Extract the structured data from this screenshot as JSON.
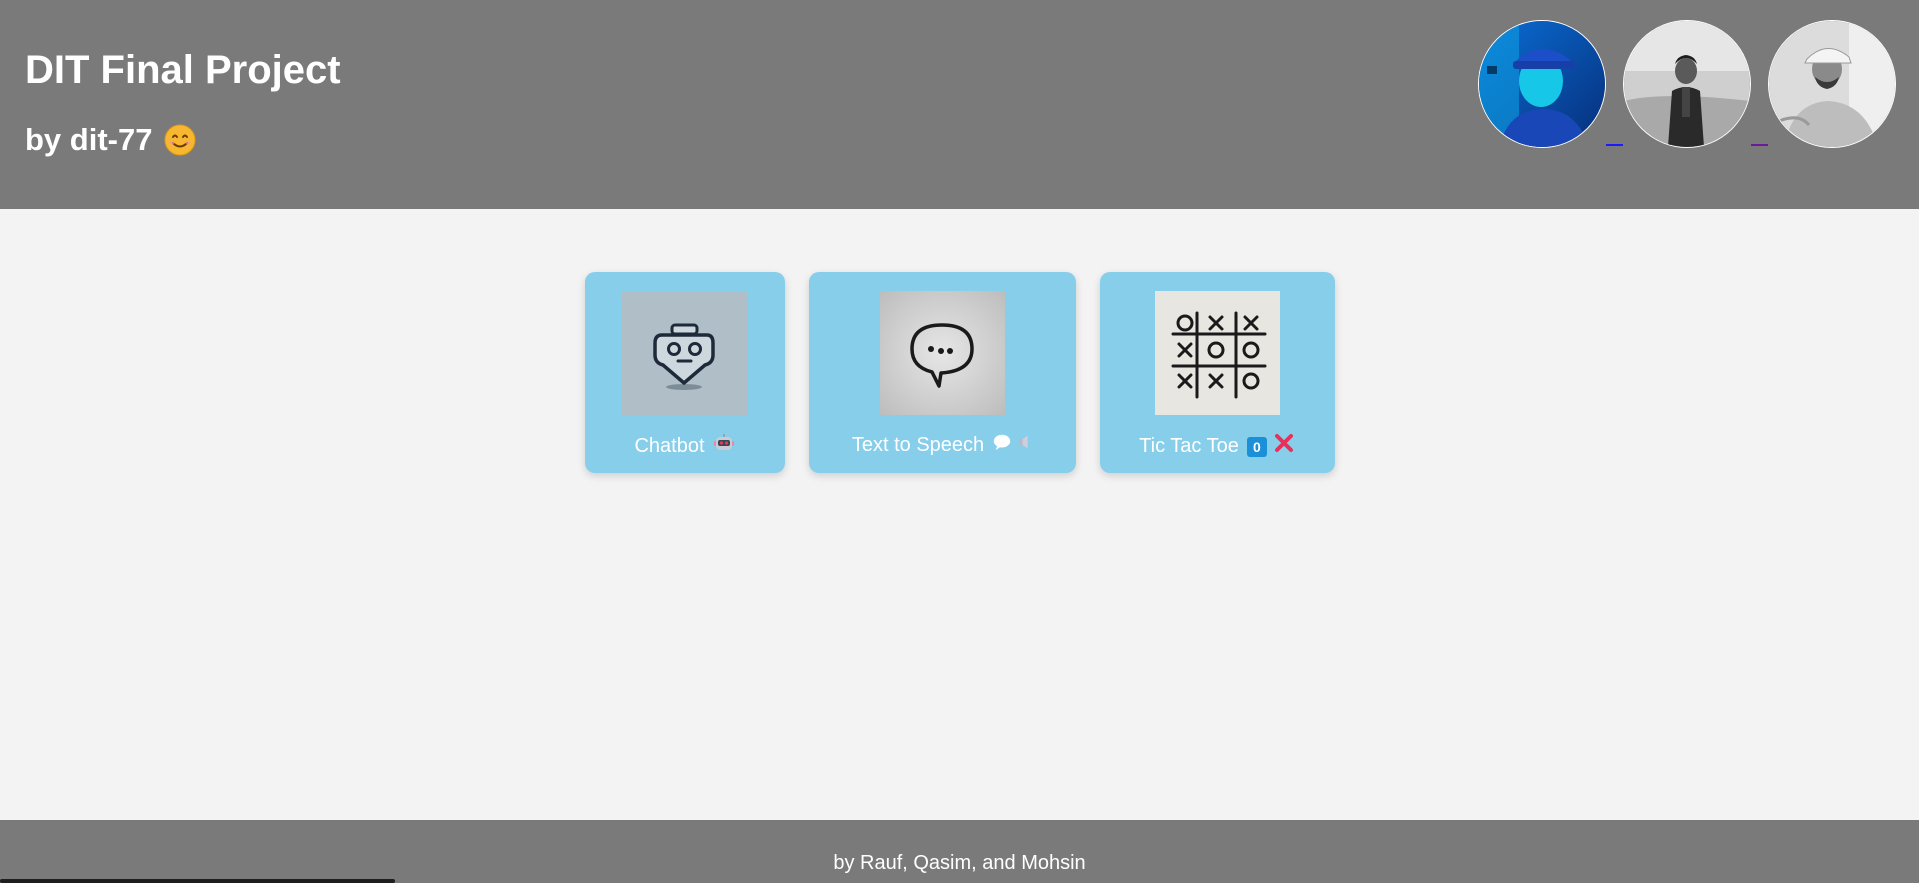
{
  "header": {
    "title": "DIT Final Project",
    "subtitle": "by dit-77",
    "subtitle_icon": "smiling-face-icon",
    "background": "#7a7a7a"
  },
  "avatars": [
    {
      "name": "avatar-1",
      "tone": "blue"
    },
    {
      "name": "avatar-2",
      "tone": "grayscale"
    },
    {
      "name": "avatar-3",
      "tone": "grayscale"
    }
  ],
  "cards": [
    {
      "label": "Chatbot",
      "icon": "robot-icon"
    },
    {
      "label": "Text to Speech",
      "icons": [
        "speech-bubble-icon",
        "speaker-icon"
      ]
    },
    {
      "label": "Tic Tac Toe",
      "icons": [
        "zero-badge-icon",
        "cross-mark-icon"
      ],
      "badge_text": "0"
    }
  ],
  "footer": {
    "text": "by Rauf, Qasim, and Mohsin"
  },
  "colors": {
    "card": "#87ceeb",
    "page": "#f3f3f3"
  }
}
